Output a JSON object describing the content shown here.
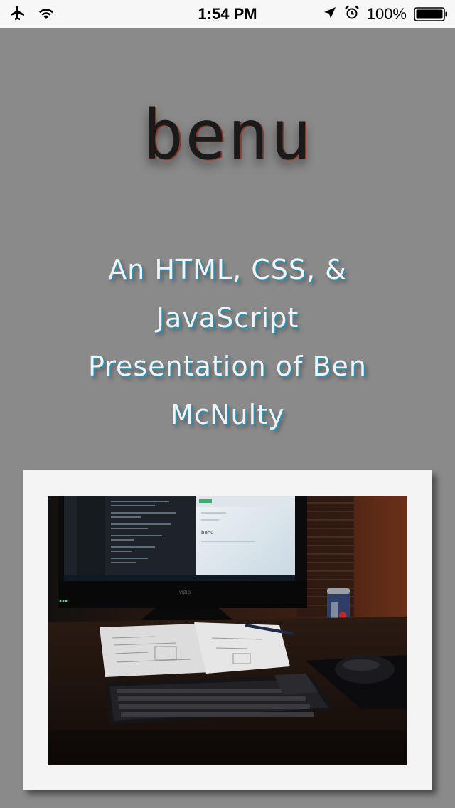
{
  "status_bar": {
    "time": "1:54 PM",
    "battery_percent": "100%",
    "icons": [
      "airplane-icon",
      "wifi-icon",
      "location-arrow-icon",
      "alarm-icon",
      "battery-icon"
    ]
  },
  "page": {
    "title": "benu",
    "subtitle": "An HTML, CSS, & JavaScript Presentation of Ben McNulty"
  },
  "photo": {
    "monitor_heading": "benu",
    "monitor_brand": "VIZIO"
  },
  "colors": {
    "background": "#8a8a8a",
    "frame": "#f4f4f4",
    "status_bar": "#f7f7f7",
    "title_text": "#1a1a1a",
    "subtitle_text": "#f2f2f2",
    "subtitle_shadow": "#2a8fb0"
  }
}
